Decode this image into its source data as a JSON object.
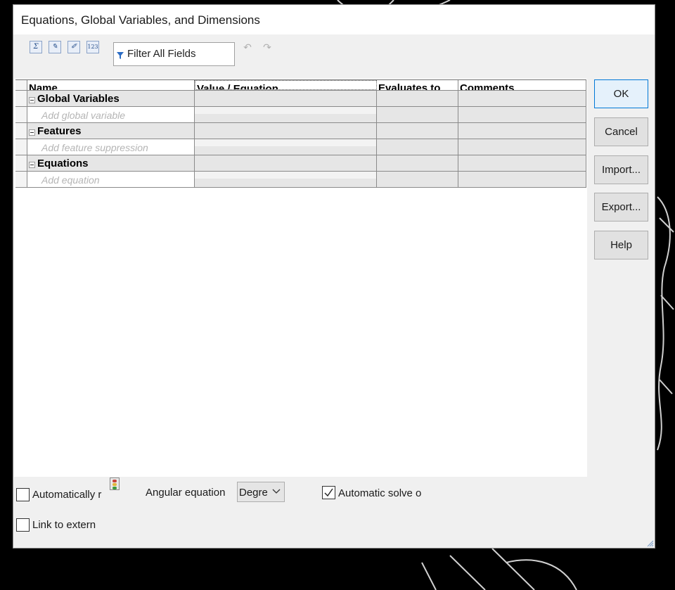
{
  "window": {
    "title": "Equations, Global Variables, and Dimensions"
  },
  "toolbar": {
    "buttons": [
      {
        "icon": "equation-view-icon",
        "glyph": "Σ"
      },
      {
        "icon": "sketch-equation-view-icon",
        "glyph": "✎"
      },
      {
        "icon": "dimension-view-icon",
        "glyph": "✐"
      },
      {
        "icon": "ordered-view-icon",
        "glyph": "123"
      }
    ],
    "filter_placeholder": "Filter All Fields",
    "undo_icon": "undo-icon",
    "redo_icon": "redo-icon"
  },
  "grid": {
    "columns": [
      "Name",
      "Value / Equation",
      "Evaluates to",
      "Comments"
    ],
    "groups": [
      {
        "label": "Global Variables",
        "placeholder": "Add global variable"
      },
      {
        "label": "Features",
        "placeholder": "Add feature suppression"
      },
      {
        "label": "Equations",
        "placeholder": "Add equation"
      }
    ]
  },
  "buttons": {
    "ok": "OK",
    "cancel": "Cancel",
    "import": "Import...",
    "export": "Export...",
    "help": "Help"
  },
  "options": {
    "auto_rebuild_label": "Automatically r",
    "auto_rebuild_checked": false,
    "angular_label": "Angular equation",
    "angular_value": "Degrees",
    "auto_solve_label": "Automatic solve o",
    "auto_solve_checked": true,
    "link_external_label": "Link to extern",
    "link_external_checked": false
  },
  "colors": {
    "accent": "#0078d7",
    "background": "#000000",
    "dialog": "#f0f0f0"
  }
}
